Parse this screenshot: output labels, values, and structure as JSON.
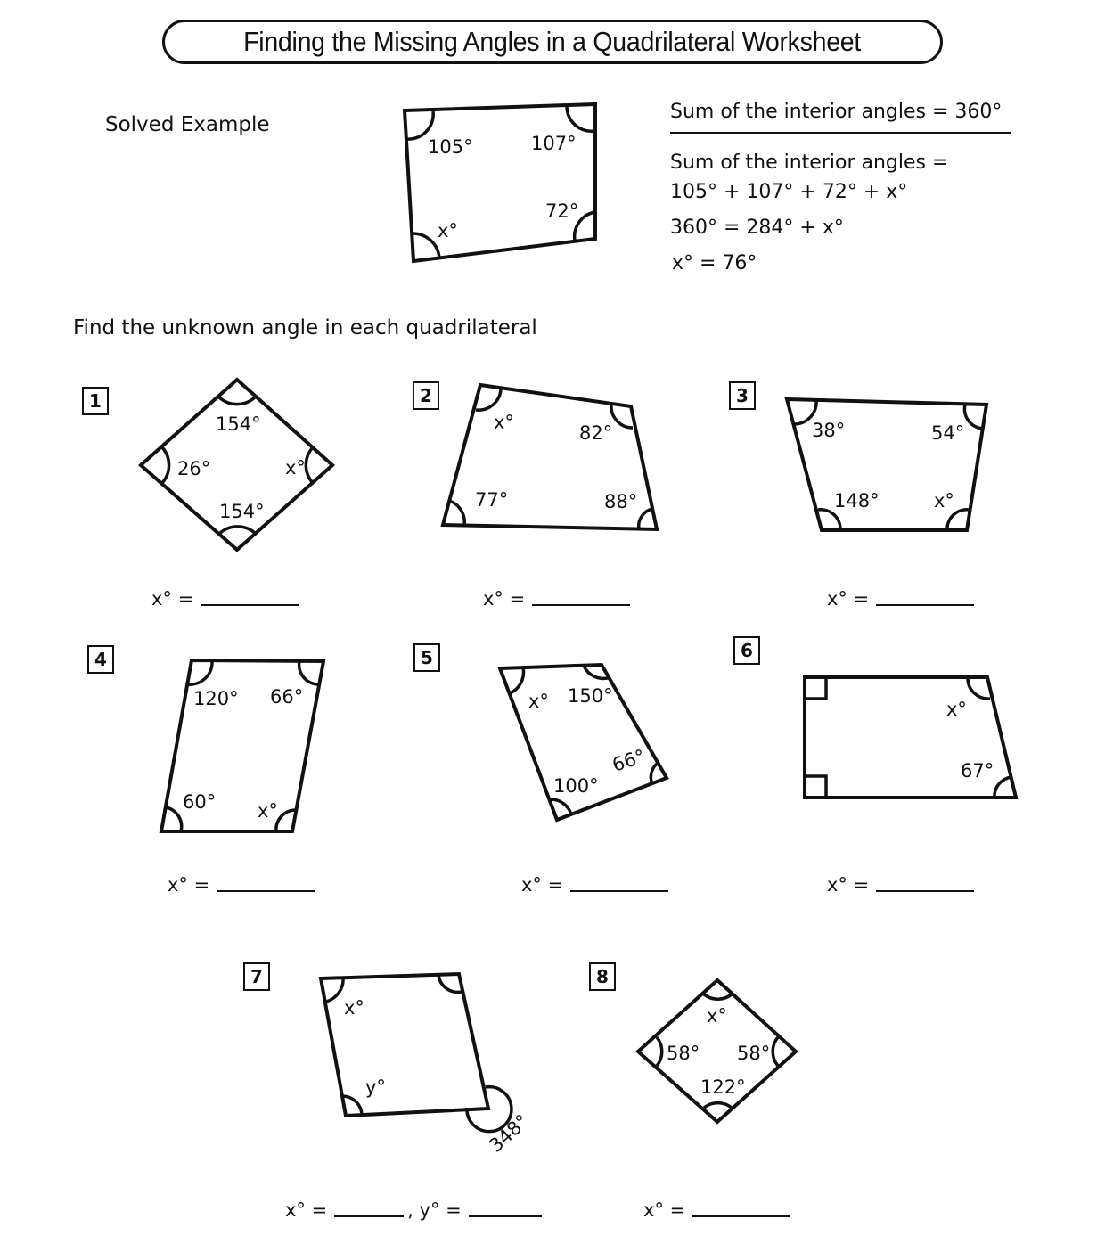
{
  "title": "Finding the Missing Angles in a  Quadrilateral Worksheet",
  "solved_example": {
    "heading": "Solved Example",
    "angles": {
      "top_left": "105°",
      "top_right": "107°",
      "bottom_right": "72°",
      "bottom_left": "x°"
    },
    "rule": "Sum of the interior angles = 360°",
    "steps": [
      "Sum of the interior angles =",
      "105° + 107° + 72° + x°",
      "360° = 284° + x°",
      "x° = 76°"
    ]
  },
  "instructions": "Find the unknown angle in each quadrilateral",
  "problems": [
    {
      "number": "1",
      "labels": [
        "154°",
        "26°",
        "x°",
        "154°"
      ],
      "answer_label": "x° ="
    },
    {
      "number": "2",
      "labels": [
        "x°",
        "82°",
        "77°",
        "88°"
      ],
      "answer_label": "x° ="
    },
    {
      "number": "3",
      "labels": [
        "38°",
        "54°",
        "148°",
        "x°"
      ],
      "answer_label": "x° ="
    },
    {
      "number": "4",
      "labels": [
        "120°",
        "66°",
        "60°",
        "x°"
      ],
      "answer_label": "x° ="
    },
    {
      "number": "5",
      "labels": [
        "x°",
        "150°",
        "66°",
        "100°"
      ],
      "answer_label": "x° ="
    },
    {
      "number": "6",
      "labels": [
        "x°",
        "67°"
      ],
      "right_angles": 2,
      "answer_label": "x° ="
    },
    {
      "number": "7",
      "labels": [
        "x°",
        "y°",
        "348°"
      ],
      "answer_label": "x° =",
      "answer_label_2": ", y° ="
    },
    {
      "number": "8",
      "labels": [
        "x°",
        "58°",
        "58°",
        "122°"
      ],
      "answer_label": "x° ="
    }
  ]
}
